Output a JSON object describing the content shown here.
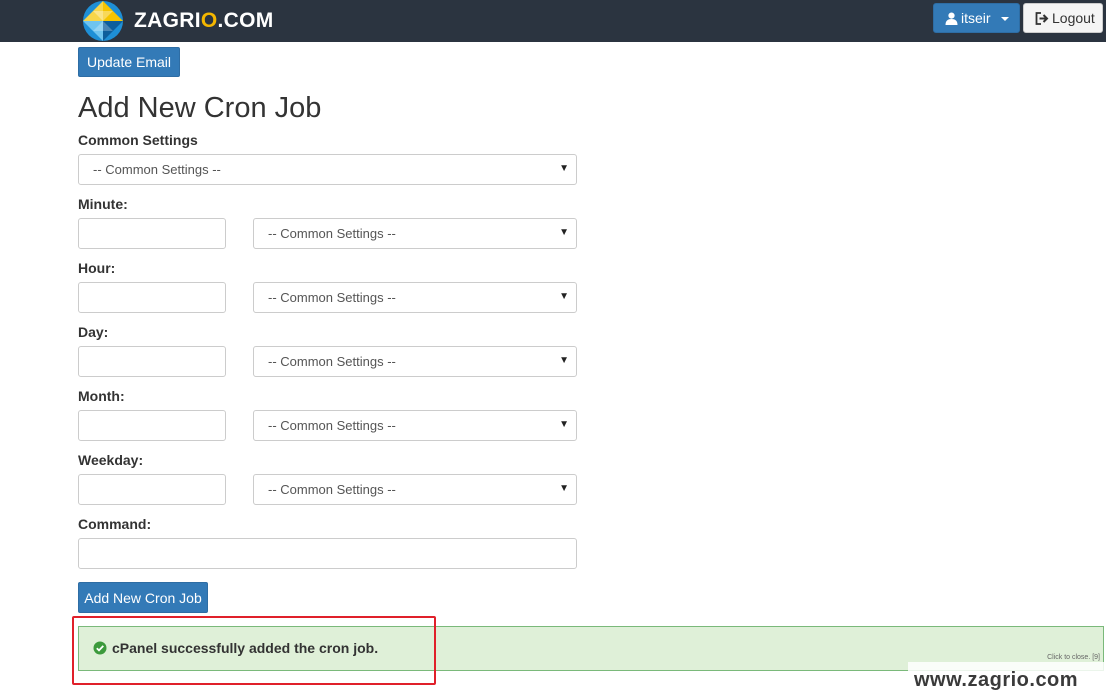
{
  "header": {
    "logo_text_main": "ZAGRI",
    "logo_text_accent": "O",
    "logo_text_tail": ".COM",
    "user_label": "itseir",
    "logout_label": "Logout",
    "user_icon": "user-icon",
    "logout_icon": "sign-out-icon"
  },
  "main": {
    "update_email_label": "Update Email",
    "title": "Add New Cron Job",
    "common_settings_label": "Common Settings",
    "common_settings_value": "-- Common Settings --",
    "fields": [
      {
        "label": "Minute:",
        "value": "",
        "select_value": "-- Common Settings --"
      },
      {
        "label": "Hour:",
        "value": "",
        "select_value": "-- Common Settings --"
      },
      {
        "label": "Day:",
        "value": "",
        "select_value": "-- Common Settings --"
      },
      {
        "label": "Month:",
        "value": "",
        "select_value": "-- Common Settings --"
      },
      {
        "label": "Weekday:",
        "value": "",
        "select_value": "-- Common Settings --"
      }
    ],
    "command_label": "Command:",
    "command_value": "",
    "add_button_label": "Add New Cron Job"
  },
  "alert": {
    "message": "cPanel successfully added the cron job.",
    "close_hint": "Click to close. [9]",
    "icon": "check-circle-icon"
  },
  "watermark": "www.zagrio.com",
  "colors": {
    "header_bg": "#2b3440",
    "primary": "#337ab7",
    "success_bg": "#dff0d8",
    "highlight_border": "#e0202a",
    "logo_accent": "#f5b700"
  }
}
